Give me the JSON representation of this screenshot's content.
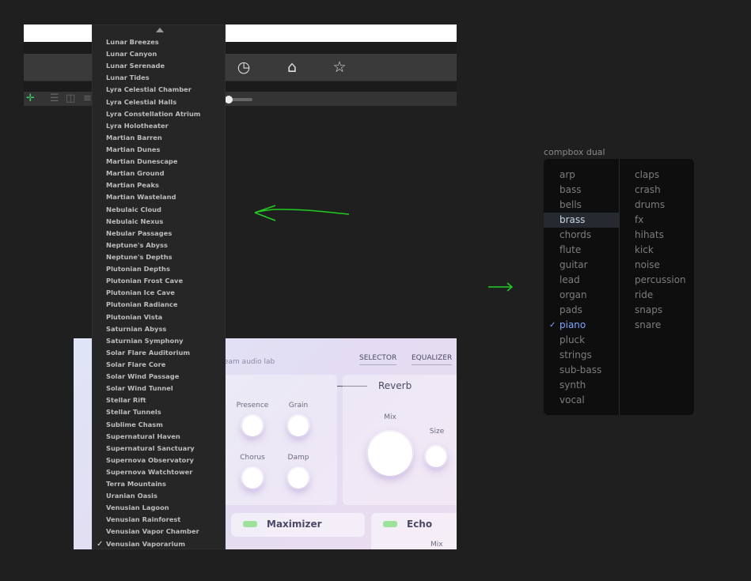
{
  "toolbar": {
    "icons": [
      "clock-icon",
      "home-icon",
      "star-icon"
    ]
  },
  "subbar": {
    "icons": [
      "move-icon",
      "align-left-icon",
      "align-top-icon",
      "distribute-icon"
    ]
  },
  "plugin": {
    "brand": "eam audio lab",
    "tabs": [
      "SELECTOR",
      "EQUALIZER"
    ],
    "knobs": [
      "Presence",
      "Grain",
      "Chorus",
      "Damp"
    ],
    "reverb": {
      "title": "Reverb",
      "mix": "Mix",
      "size": "Size"
    },
    "maximizer": "Maximizer",
    "echo": {
      "title": "Echo",
      "mix": "Mix"
    }
  },
  "dropdown": {
    "selected": "Venusian Vaporarium",
    "check": "✓",
    "items": [
      "Lunar Breezes",
      "Lunar Canyon",
      "Lunar Serenade",
      "Lunar Tides",
      "Lyra Celestial Chamber",
      "Lyra Celestial Halls",
      "Lyra Constellation Atrium",
      "Lyra Holotheater",
      "Martian Barren",
      "Martian Dunes",
      "Martian Dunescape",
      "Martian Ground",
      "Martian Peaks",
      "Martian Wasteland",
      "Nebulaic Cloud",
      "Nebulaic Nexus",
      "Nebular Passages",
      "Neptune's Abyss",
      "Neptune's Depths",
      "Plutonian Depths",
      "Plutonian Frost Cave",
      "Plutonian Ice Cave",
      "Plutonian Radiance",
      "Plutonian Vista",
      "Saturnian Abyss",
      "Saturnian Symphony",
      "Solar Flare Auditorium",
      "Solar Flare Core",
      "Solar Wind Passage",
      "Solar Wind Tunnel",
      "Stellar Rift",
      "Stellar Tunnels",
      "Sublime Chasm",
      "Supernatural Haven",
      "Supernatural Sanctuary",
      "Supernova Observatory",
      "Supernova Watchtower",
      "Terra Mountains",
      "Uranian Oasis",
      "Venusian Lagoon",
      "Venusian Rainforest",
      "Venusian Vapor Chamber",
      "Venusian Vaporarium"
    ]
  },
  "annotation_color": "#22cc22",
  "compbox": {
    "label": "compbox dual",
    "highlighted": "brass",
    "selected": "piano",
    "left": [
      "arp",
      "bass",
      "bells",
      "brass",
      "chords",
      "flute",
      "guitar",
      "lead",
      "organ",
      "pads",
      "piano",
      "pluck",
      "strings",
      "sub-bass",
      "synth",
      "vocal"
    ],
    "right": [
      "claps",
      "crash",
      "drums",
      "fx",
      "hihats",
      "kick",
      "noise",
      "percussion",
      "ride",
      "snaps",
      "snare"
    ]
  }
}
